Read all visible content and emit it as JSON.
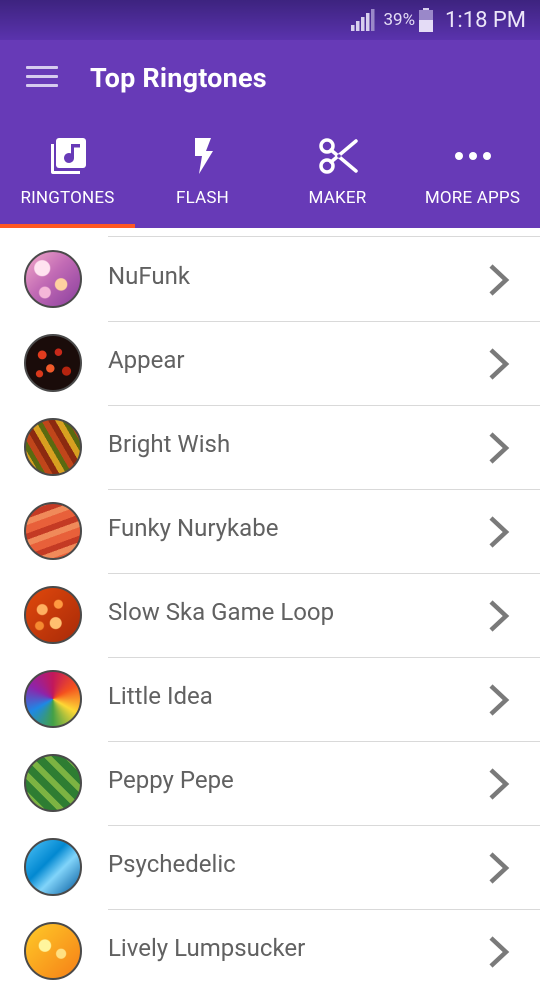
{
  "status_bar": {
    "battery_percent": "39%",
    "time": "1:18 PM"
  },
  "app_bar": {
    "title": "Top Ringtones"
  },
  "tabs": [
    {
      "label": "RINGTONES",
      "icon": "music-library-icon",
      "selected": true
    },
    {
      "label": "FLASH",
      "icon": "flash-icon",
      "selected": false
    },
    {
      "label": "MAKER",
      "icon": "scissors-icon",
      "selected": false
    },
    {
      "label": "MORE APPS",
      "icon": "more-dots-icon",
      "selected": false
    }
  ],
  "colors": {
    "primary": "#673ab7",
    "status_bar": "#4a2a91",
    "tab_indicator": "#ff5722",
    "text": "#616161",
    "divider": "#d9d9d9"
  },
  "ringtones": [
    {
      "name": "NuFunk",
      "thumb": "pink-bokeh"
    },
    {
      "name": "Appear",
      "thumb": "red-dots-on-black"
    },
    {
      "name": "Bright Wish",
      "thumb": "orange-stripes"
    },
    {
      "name": "Funky Nurykabe",
      "thumb": "red-waves"
    },
    {
      "name": "Slow Ska Game Loop",
      "thumb": "orange-bubbles"
    },
    {
      "name": "Little Idea",
      "thumb": "colorful-swirl"
    },
    {
      "name": "Peppy Pepe",
      "thumb": "green-diamonds"
    },
    {
      "name": "Psychedelic",
      "thumb": "blue-water"
    },
    {
      "name": "Lively Lumpsucker",
      "thumb": "yellow-bokeh"
    }
  ]
}
